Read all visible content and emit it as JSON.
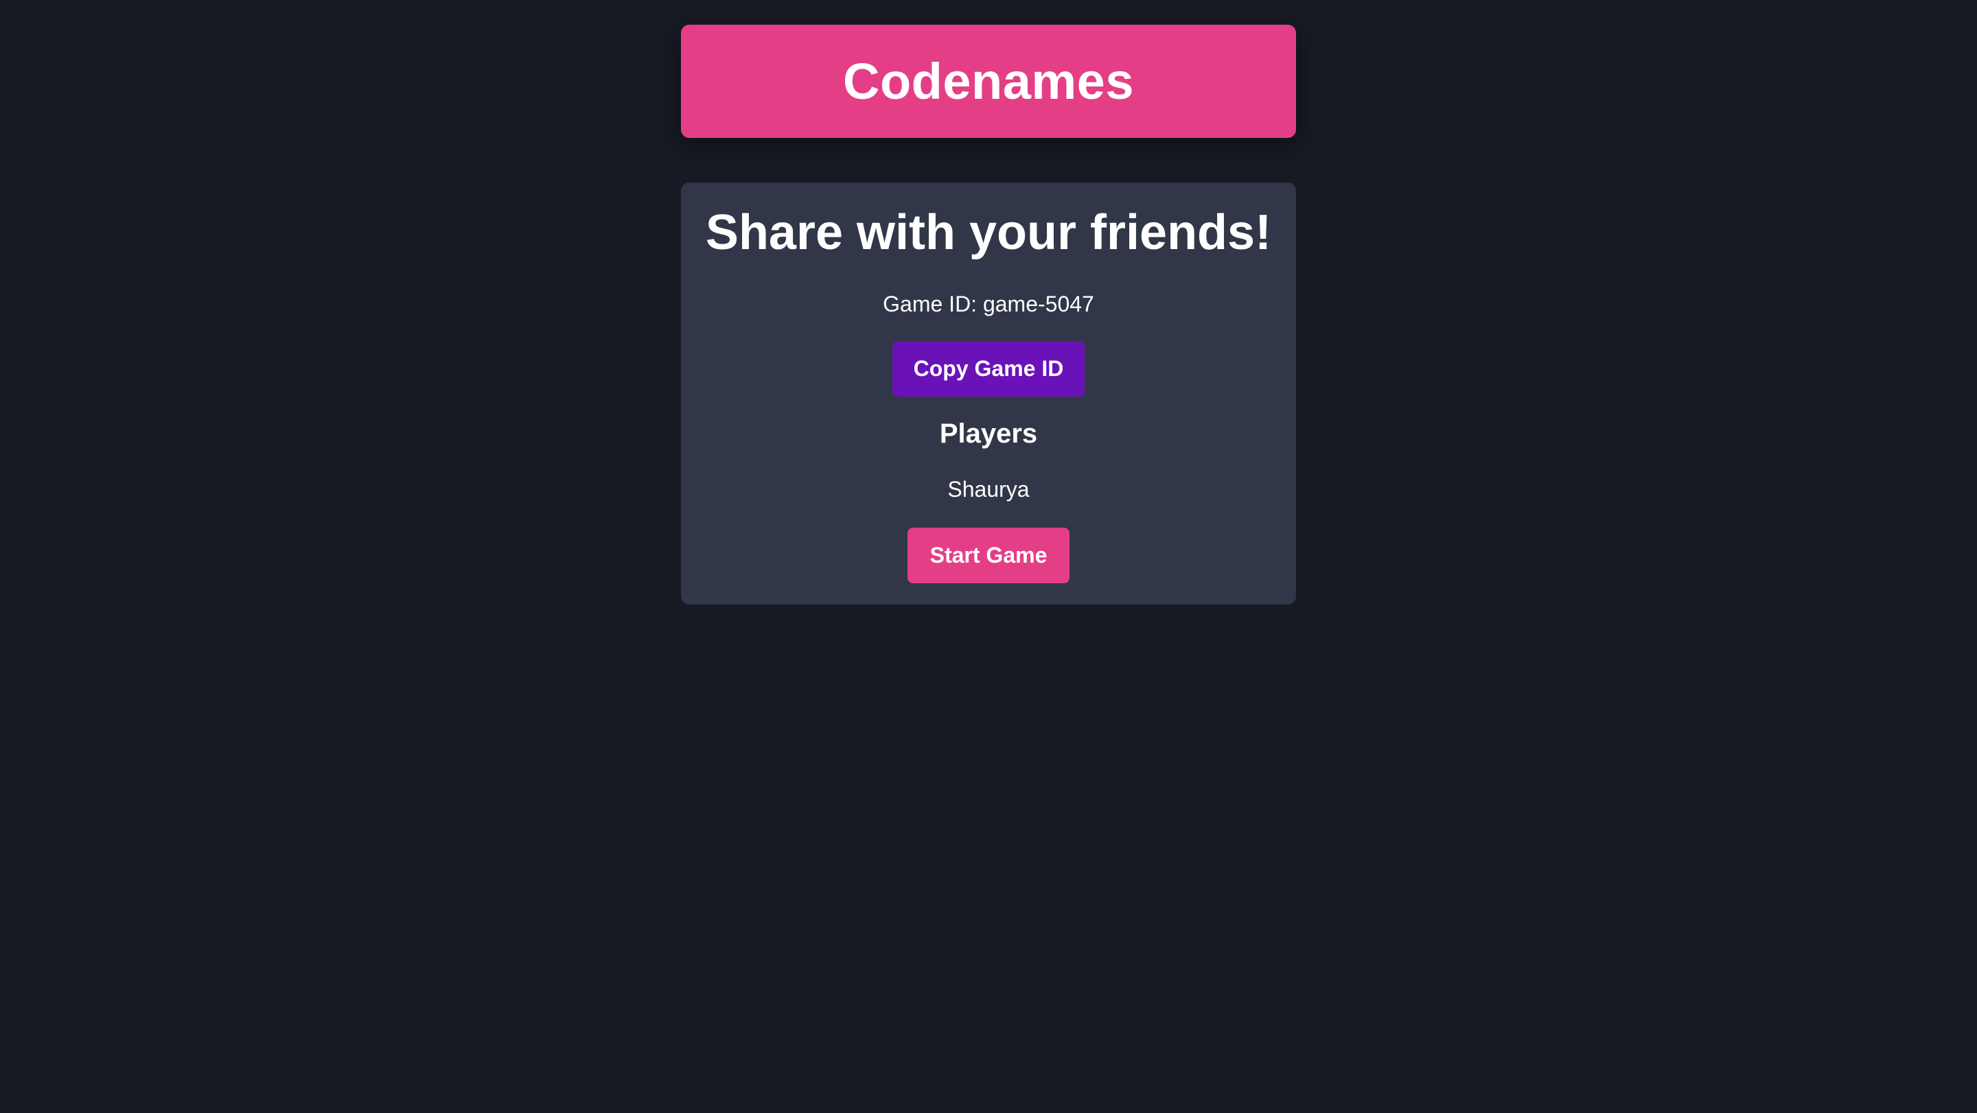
{
  "header": {
    "title": "Codenames"
  },
  "share_card": {
    "title": "Share with your friends!",
    "game_id_text": "Game ID: game-5047",
    "copy_button_label": "Copy Game ID",
    "players_title": "Players",
    "players": [
      "Shaurya"
    ],
    "start_button_label": "Start Game"
  },
  "colors": {
    "background": "#171923",
    "card": "#313748",
    "brand_pink": "#E43F86",
    "purple": "#6A12B8",
    "text": "#FFFFFF"
  }
}
